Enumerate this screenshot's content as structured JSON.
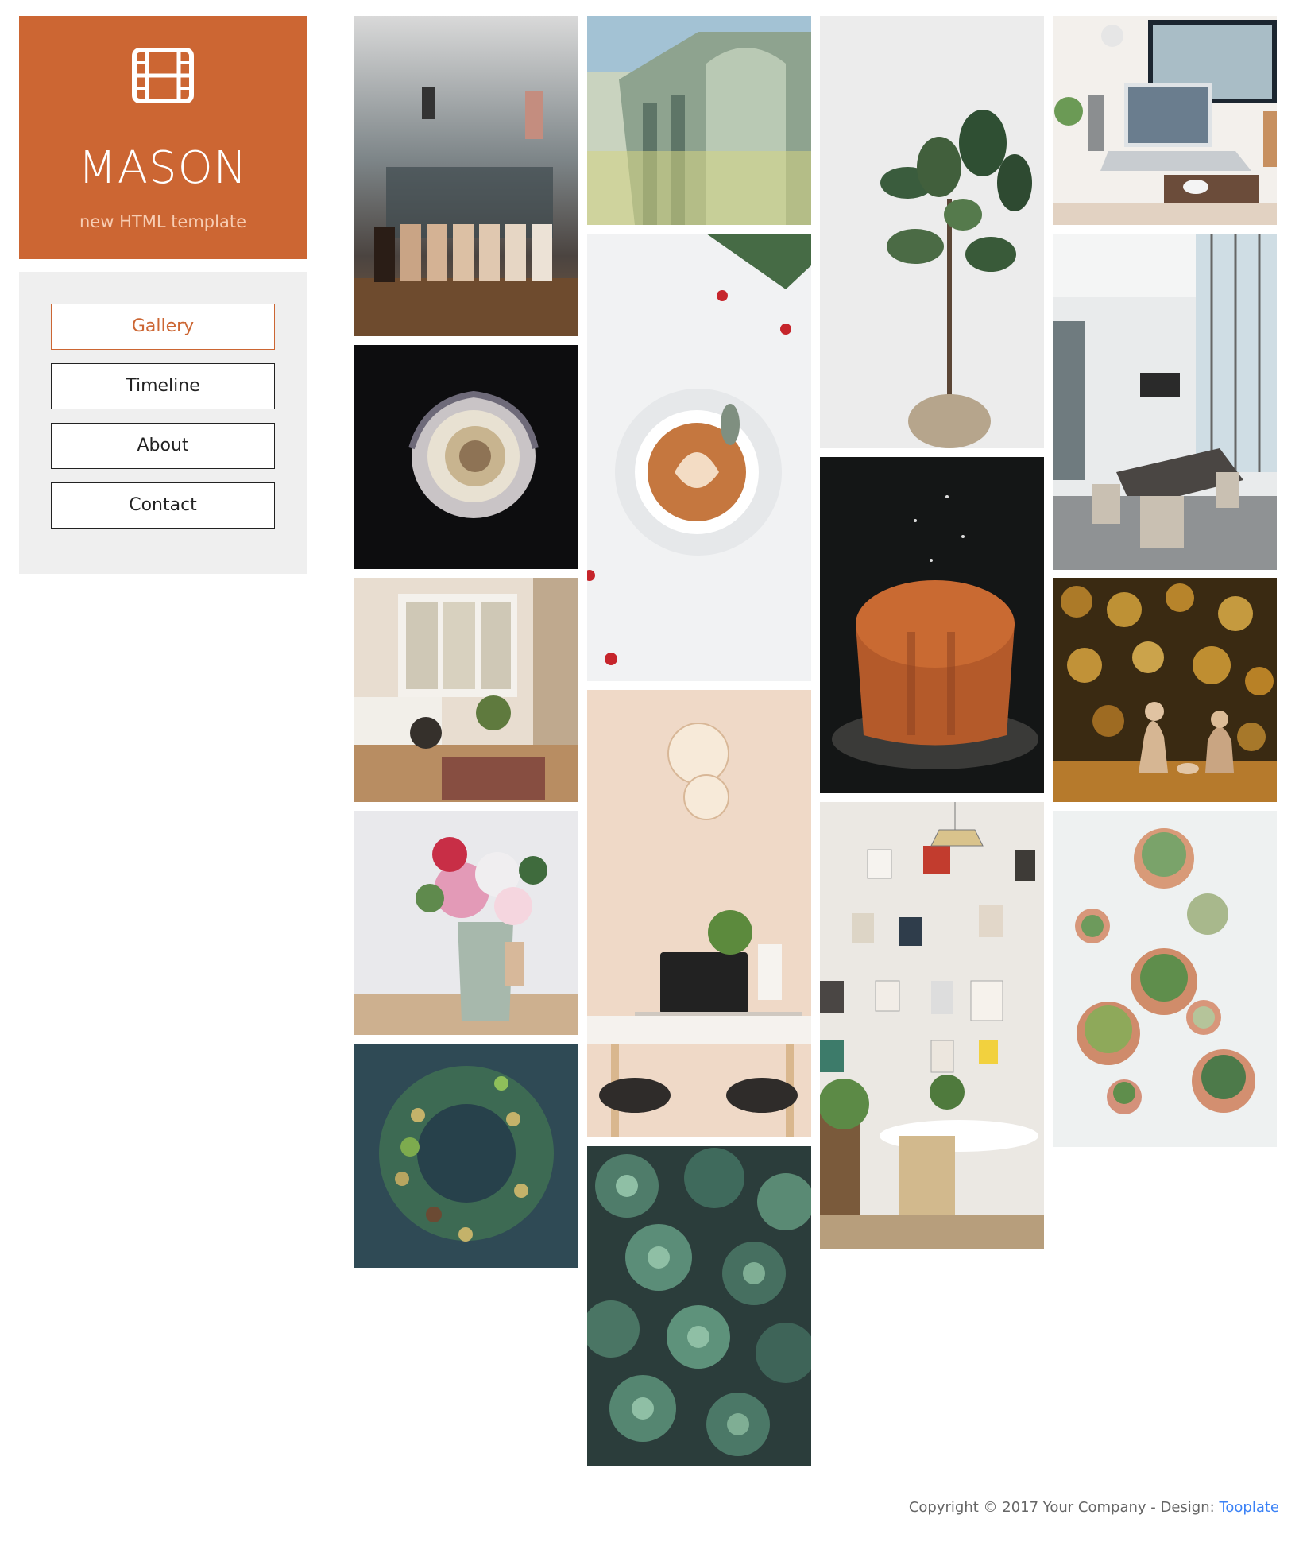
{
  "brand": {
    "title": "MASON",
    "tagline": "new HTML template",
    "icon": "film-icon",
    "accent": "#cc6633"
  },
  "nav": {
    "items": [
      {
        "label": "Gallery",
        "active": true
      },
      {
        "label": "Timeline",
        "active": false
      },
      {
        "label": "About",
        "active": false
      },
      {
        "label": "Contact",
        "active": false
      }
    ]
  },
  "gallery": {
    "photos": [
      "coffee-bar-jars",
      "dark-rose",
      "sunny-bedroom",
      "pink-flower-vase",
      "green-wreath",
      "banknote-building",
      "latte-art",
      "desk-laptop-lamp",
      "succulents-pattern",
      "fiddle-leaf-tree",
      "bundt-cake",
      "clipboard-wall-dining",
      "desk-imac-laptop",
      "conference-room",
      "bokeh-figurines",
      "potted-succulents"
    ]
  },
  "footer": {
    "copyright": "Copyright © 2017 Your Company - Design:",
    "link": "Tooplate"
  }
}
